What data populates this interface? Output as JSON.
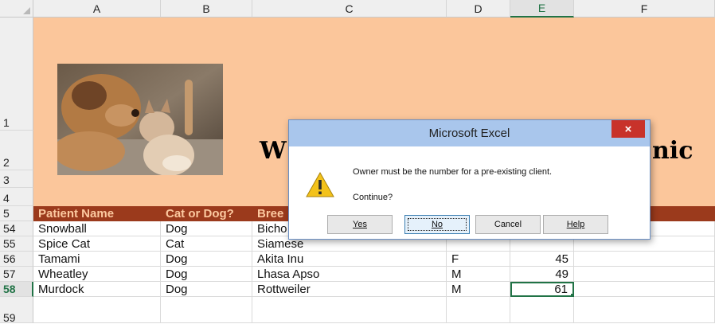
{
  "columns": [
    "A",
    "B",
    "C",
    "D",
    "E",
    "F"
  ],
  "selected_column": "E",
  "rows": [
    {
      "label": "1"
    },
    {
      "label": "2"
    },
    {
      "label": "3"
    },
    {
      "label": "4"
    },
    {
      "label": "5"
    },
    {
      "label": "54"
    },
    {
      "label": "55"
    },
    {
      "label": "56"
    },
    {
      "label": "57"
    },
    {
      "label": "58"
    },
    {
      "label": "59"
    }
  ],
  "title_visible": {
    "left": "W",
    "right": "nic"
  },
  "header_row": {
    "a": "Patient Name",
    "b": "Cat or Dog?",
    "c": "Bree"
  },
  "data_rows": [
    {
      "a": "Snowball",
      "b": "Dog",
      "c": "Bicho",
      "d": "",
      "e": ""
    },
    {
      "a": "Spice Cat",
      "b": "Cat",
      "c": "Siamese",
      "d": "",
      "e": ""
    },
    {
      "a": "Tamami",
      "b": "Dog",
      "c": "Akita Inu",
      "d": "F",
      "e": "45"
    },
    {
      "a": "Wheatley",
      "b": "Dog",
      "c": "Lhasa Apso",
      "d": "M",
      "e": "49"
    },
    {
      "a": "Murdock",
      "b": "Dog",
      "c": "Rottweiler",
      "d": "M",
      "e": "61"
    }
  ],
  "dialog": {
    "title": "Microsoft Excel",
    "close_label": "×",
    "message": "Owner must be the number for a pre-existing client.",
    "question": "Continue?",
    "buttons": {
      "yes": "Yes",
      "no": "No",
      "cancel": "Cancel",
      "help": "Help"
    }
  },
  "colors": {
    "accent": "#217346",
    "header_band": "#9b3a1c",
    "peach": "#fbc69b",
    "dialog_title_bg": "#a9c6ec",
    "close_red": "#c8322a"
  }
}
